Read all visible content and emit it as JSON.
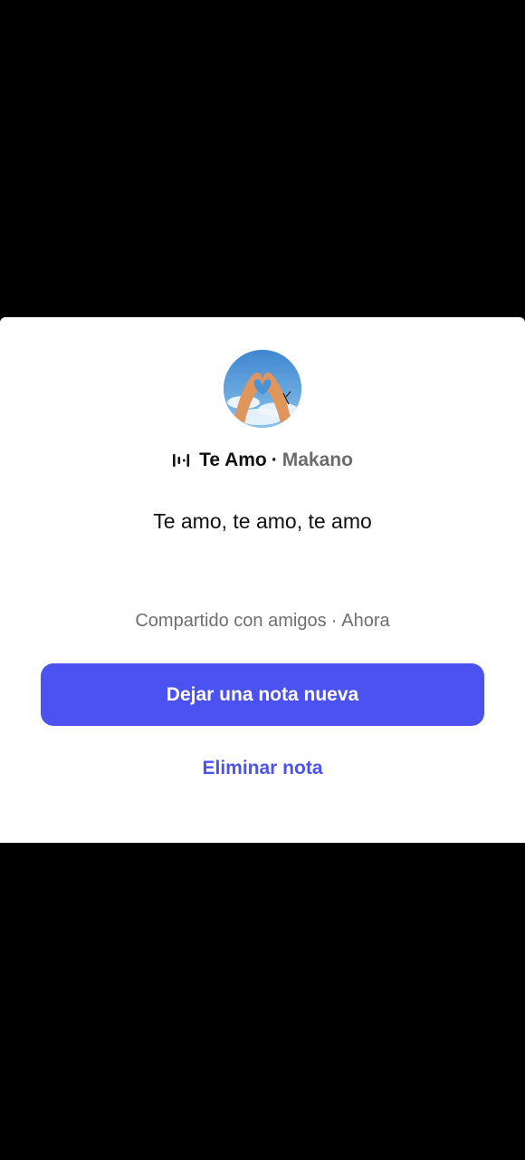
{
  "note": {
    "avatar_icon": "heart-hands-sky-photo",
    "music": {
      "icon": "audio-wave-icon",
      "title": "Te Amo",
      "separator": "·",
      "artist": "Makano"
    },
    "text": "Te amo, te amo, te amo",
    "audience": "Compartido con amigos",
    "audience_separator": "·",
    "time": "Ahora"
  },
  "actions": {
    "new_note_label": "Dejar una nota nueva",
    "delete_note_label": "Eliminar nota"
  },
  "colors": {
    "accent": "#4c52f0",
    "sheet_background": "#ffffff",
    "backdrop": "#000000"
  }
}
